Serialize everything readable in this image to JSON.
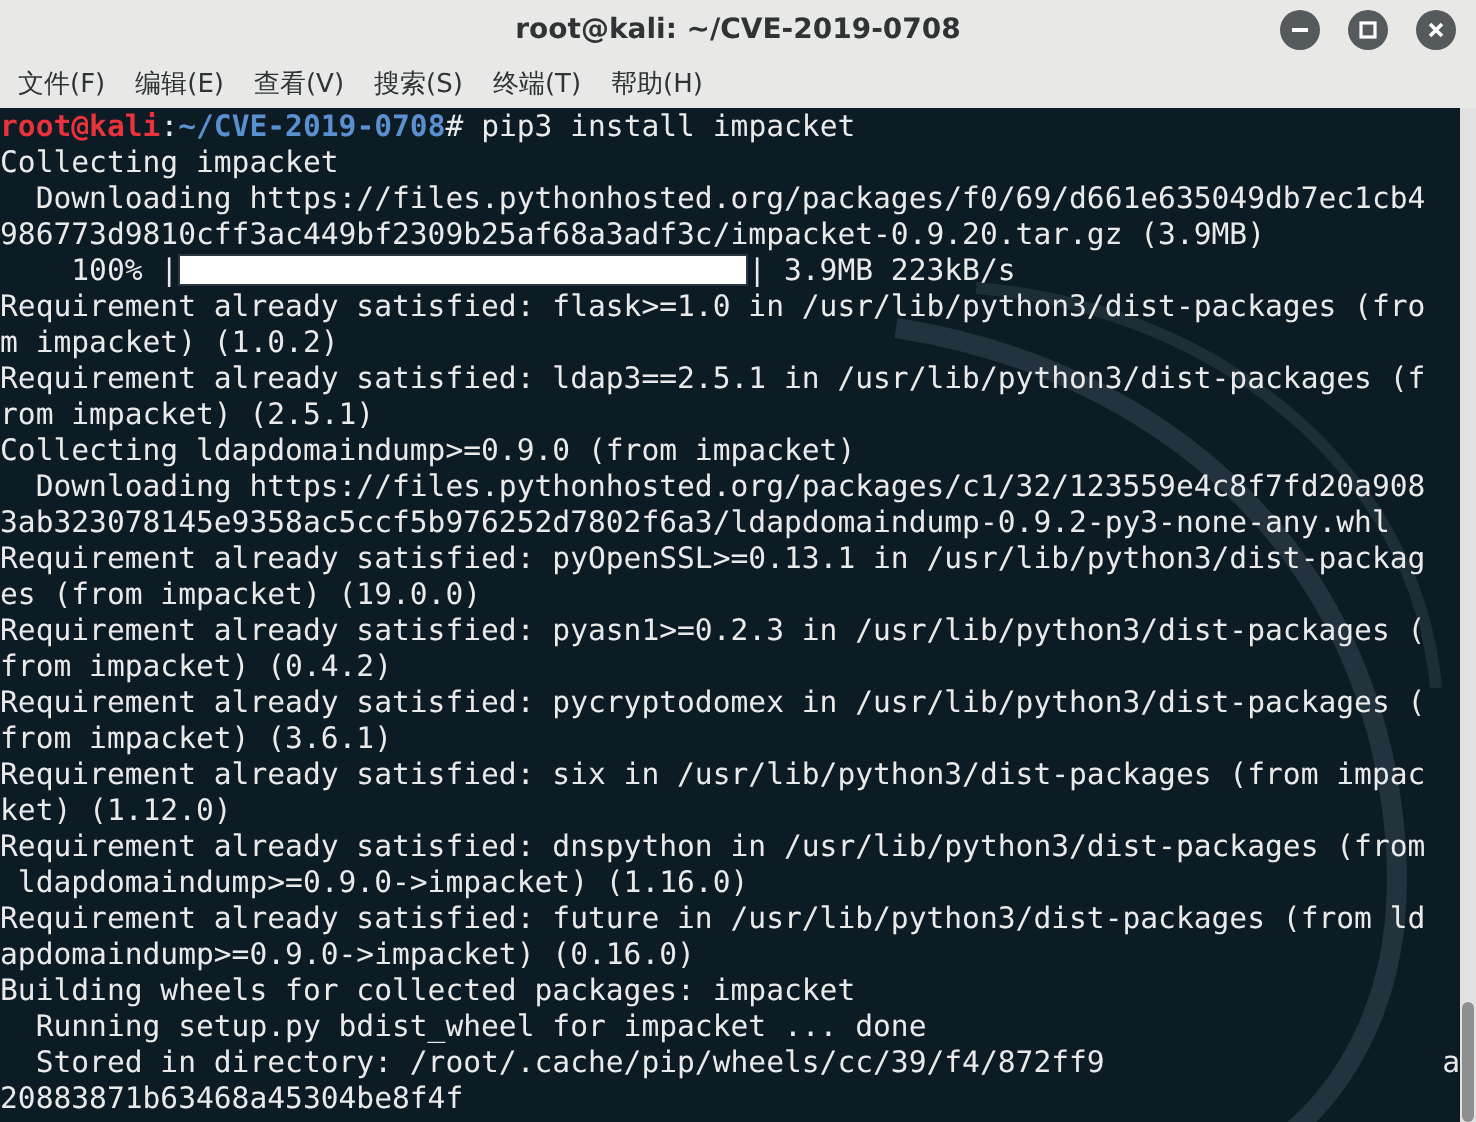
{
  "window": {
    "title": "root@kali: ~/CVE-2019-0708"
  },
  "menu": [
    "文件(F)",
    "编辑(E)",
    "查看(V)",
    "搜索(S)",
    "终端(T)",
    "帮助(H)"
  ],
  "terminal": {
    "lines": [
      {
        "kind": "prompt",
        "user": "root@kali",
        "sep": ":",
        "path": "~/CVE-2019-0708",
        "command": "# pip3 install impacket"
      },
      {
        "kind": "text",
        "text": "Collecting impacket"
      },
      {
        "kind": "text",
        "text": "  Downloading https://files.pythonhosted.org/packages/f0/69/d661e635049db7ec1cb4"
      },
      {
        "kind": "text",
        "text": "986773d9810cff3ac449bf2309b25af68a3adf3c/impacket-0.9.20.tar.gz (3.9MB)"
      },
      {
        "kind": "progress",
        "prefix": "    100% |",
        "level": 1,
        "suffix": "| 3.9MB 223kB/s"
      },
      {
        "kind": "text",
        "text": "Requirement already satisfied: flask>=1.0 in /usr/lib/python3/dist-packages (fro"
      },
      {
        "kind": "text",
        "text": "m impacket) (1.0.2)"
      },
      {
        "kind": "text",
        "text": "Requirement already satisfied: ldap3==2.5.1 in /usr/lib/python3/dist-packages (f"
      },
      {
        "kind": "text",
        "text": "rom impacket) (2.5.1)"
      },
      {
        "kind": "text",
        "text": "Collecting ldapdomaindump>=0.9.0 (from impacket)"
      },
      {
        "kind": "text",
        "text": "  Downloading https://files.pythonhosted.org/packages/c1/32/123559e4c8f7fd20a908"
      },
      {
        "kind": "text",
        "text": "3ab323078145e9358ac5ccf5b976252d7802f6a3/ldapdomaindump-0.9.2-py3-none-any.whl"
      },
      {
        "kind": "text",
        "text": "Requirement already satisfied: pyOpenSSL>=0.13.1 in /usr/lib/python3/dist-packag"
      },
      {
        "kind": "text",
        "text": "es (from impacket) (19.0.0)"
      },
      {
        "kind": "text",
        "text": "Requirement already satisfied: pyasn1>=0.2.3 in /usr/lib/python3/dist-packages ("
      },
      {
        "kind": "text",
        "text": "from impacket) (0.4.2)"
      },
      {
        "kind": "text",
        "text": "Requirement already satisfied: pycryptodomex in /usr/lib/python3/dist-packages ("
      },
      {
        "kind": "text",
        "text": "from impacket) (3.6.1)"
      },
      {
        "kind": "text",
        "text": "Requirement already satisfied: six in /usr/lib/python3/dist-packages (from impac"
      },
      {
        "kind": "text",
        "text": "ket) (1.12.0)"
      },
      {
        "kind": "text",
        "text": "Requirement already satisfied: dnspython in /usr/lib/python3/dist-packages (from"
      },
      {
        "kind": "text",
        "text": " ldapdomaindump>=0.9.0->impacket) (1.16.0)"
      },
      {
        "kind": "text",
        "text": "Requirement already satisfied: future in /usr/lib/python3/dist-packages (from ld"
      },
      {
        "kind": "text",
        "text": "apdomaindump>=0.9.0->impacket) (0.16.0)"
      },
      {
        "kind": "text",
        "text": "Building wheels for collected packages: impacket"
      },
      {
        "kind": "text",
        "text": "  Running setup.py bdist_wheel for impacket ... done"
      },
      {
        "kind": "text",
        "text": "  Stored in directory: /root/.cache/pip/wheels/cc/39/f4/872ff9",
        "tail": "a"
      },
      {
        "kind": "text",
        "text": "20883871b63468a45304be8f4f"
      }
    ]
  }
}
